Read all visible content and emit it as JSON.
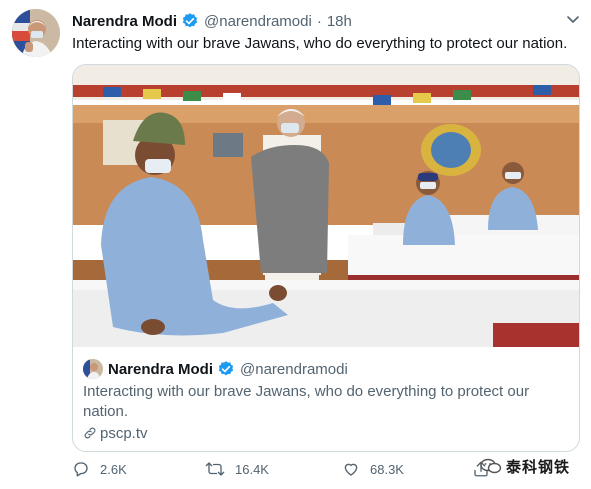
{
  "tweet": {
    "author_name": "Narendra Modi",
    "handle": "@narendramodi",
    "separator": "·",
    "time": "18h",
    "text": "Interacting with our brave Jawans, who do everything to protect our nation."
  },
  "quoted": {
    "author_name": "Narendra Modi",
    "handle": "@narendramodi",
    "text": "Interacting with our brave Jawans, who do everything to protect our nation.",
    "link": "pscp.tv"
  },
  "actions": {
    "replies": "2.6K",
    "retweets": "16.4K",
    "likes": "68.3K"
  },
  "watermark": "泰科钢铁",
  "colors": {
    "verified": "#1d9bf0",
    "muted": "#536471",
    "border": "#cfd9de"
  },
  "icons": [
    "verified-badge-icon",
    "chevron-down-icon",
    "link-icon",
    "reply-icon",
    "retweet-icon",
    "like-icon",
    "share-icon",
    "wechat-icon"
  ]
}
